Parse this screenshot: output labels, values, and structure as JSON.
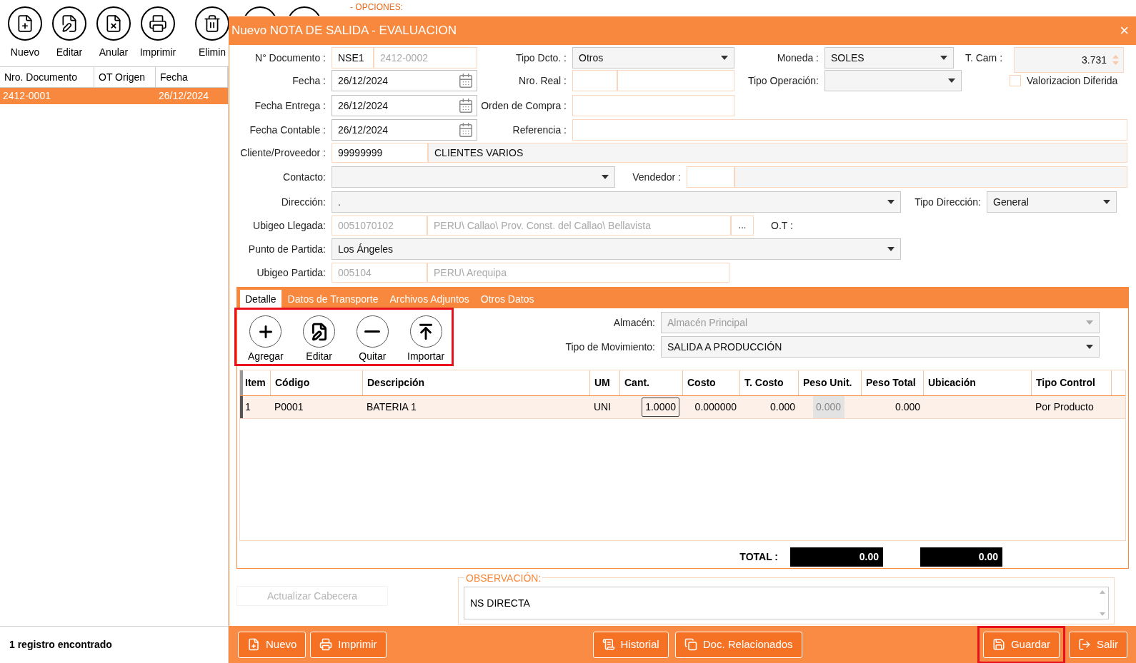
{
  "background": {
    "toolbar": [
      {
        "label": "Nuevo",
        "kind": "new"
      },
      {
        "label": "Editar",
        "kind": "edit"
      },
      {
        "label": "Anular",
        "kind": "void"
      },
      {
        "label": "Imprimir",
        "kind": "print"
      },
      {
        "label": "Elimin",
        "kind": "delete"
      }
    ],
    "options_label": "- OPCIONES:",
    "table": {
      "columns": [
        "Nro. Documento",
        "OT Origen",
        "Fecha"
      ],
      "rows": [
        {
          "cells": [
            "2412-0001",
            "",
            "26/12/2024"
          ],
          "selected": true
        }
      ]
    },
    "status": "1 registro encontrado"
  },
  "dialog": {
    "title": "Nuevo NOTA DE SALIDA - EVALUACION",
    "close": "×",
    "documento": {
      "label": "N° Documento :",
      "serie": "NSE1",
      "numero": "2412-0002"
    },
    "tipo_dcto": {
      "label": "Tipo Dcto. :",
      "value": "Otros"
    },
    "moneda": {
      "label": "Moneda :",
      "value": "SOLES"
    },
    "t_cam": {
      "label": "T. Cam :",
      "value": "3.731"
    },
    "fecha": {
      "label": "Fecha :",
      "value": "26/12/2024"
    },
    "nro_real": {
      "label": "Nro. Real :"
    },
    "tipo_operacion": {
      "label": "Tipo Operación:"
    },
    "valorizacion": {
      "label": "Valorizacion Diferida",
      "checked": false
    },
    "fecha_entrega": {
      "label": "Fecha Entrega :",
      "value": "26/12/2024"
    },
    "orden_compra": {
      "label": "Orden de Compra :"
    },
    "fecha_contable": {
      "label": "Fecha Contable :",
      "value": "26/12/2024"
    },
    "referencia": {
      "label": "Referencia :"
    },
    "cliente": {
      "label": "Cliente/Proveedor :",
      "code": "99999999",
      "name": "CLIENTES VARIOS"
    },
    "contacto": {
      "label": "Contacto:"
    },
    "vendedor": {
      "label": "Vendedor :"
    },
    "direccion": {
      "label": "Dirección:",
      "value": "."
    },
    "tipo_direccion": {
      "label": "Tipo Dirección:",
      "value": "General"
    },
    "ubigeo_llegada": {
      "label": "Ubigeo Llegada:",
      "code": "0051070102",
      "name": "PERU\\ Callao\\ Prov. Const. del Callao\\ Bellavista",
      "button": "..."
    },
    "ot": {
      "label": "O.T :"
    },
    "punto_partida": {
      "label": "Punto de Partida:",
      "value": "Los Ángeles"
    },
    "ubigeo_partida": {
      "label": "Ubigeo Partida:",
      "code": "005104",
      "name": "PERU\\ Arequipa"
    },
    "tabs": [
      {
        "label": "Detalle",
        "selected": true
      },
      {
        "label": "Datos de Transporte",
        "selected": false
      },
      {
        "label": "Archivos Adjuntos",
        "selected": false
      },
      {
        "label": "Otros Datos",
        "selected": false
      }
    ],
    "tools": [
      {
        "label": "Agregar",
        "kind": "add"
      },
      {
        "label": "Editar",
        "kind": "edit"
      },
      {
        "label": "Quitar",
        "kind": "remove"
      },
      {
        "label": "Importar",
        "kind": "import"
      }
    ],
    "almacen": {
      "label": "Almacén:",
      "value": "Almacén Principal",
      "disabled": true
    },
    "tipo_movimiento": {
      "label": "Tipo de Movimiento:",
      "value": "SALIDA A PRODUCCIÓN"
    },
    "table": {
      "columns": [
        "Item",
        "Código",
        "Descripción",
        "UM",
        "Cant.",
        "Costo",
        "T. Costo",
        "Peso Unit.",
        "Peso Total",
        "Ubicación",
        "Tipo Control"
      ],
      "rows": [
        {
          "cells": [
            "1",
            "P0001",
            "BATERIA 1",
            "UNI",
            "1.0000",
            "0.000000",
            "0.000",
            "0.000",
            "0.000",
            "",
            "Por Producto"
          ],
          "selected": true
        }
      ]
    },
    "total": {
      "label": "TOTAL :",
      "values": [
        "0.00",
        "0.00"
      ]
    },
    "actualizar": {
      "label": "Actualizar Cabecera",
      "disabled": true
    },
    "observacion": {
      "legend": "OBSERVACIÓN:",
      "value": "NS DIRECTA"
    },
    "footer_left": [
      {
        "label": "Nuevo",
        "kind": "new",
        "highlighted": false
      },
      {
        "label": "Imprimir",
        "kind": "print",
        "highlighted": false
      }
    ],
    "footer_center": [
      {
        "label": "Historial",
        "kind": "history",
        "highlighted": false
      },
      {
        "label": "Doc. Relacionados",
        "kind": "related",
        "highlighted": false
      }
    ],
    "footer_right": [
      {
        "label": "Guardar",
        "kind": "save",
        "highlighted": true
      },
      {
        "label": "Salir",
        "kind": "exit",
        "highlighted": false
      }
    ]
  }
}
